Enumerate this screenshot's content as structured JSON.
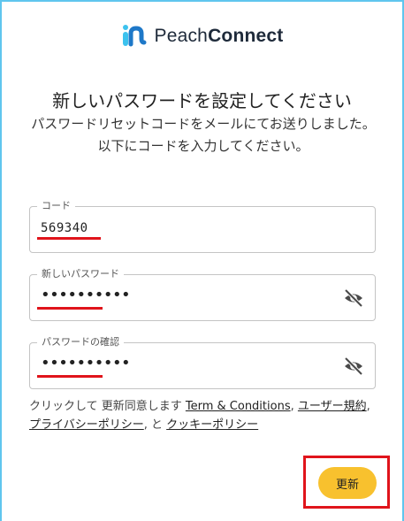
{
  "brand": {
    "name_light": "Peach",
    "name_bold": "Connect"
  },
  "page": {
    "title": "新しいパスワードを設定してください",
    "subtitle": "パスワードリセットコードをメールにてお送りしました。以下にコードを入力してください。"
  },
  "fields": {
    "code": {
      "label": "コード",
      "value": "569340"
    },
    "new_password": {
      "label": "新しいパスワード",
      "value": "••••••••••",
      "icon": "eye-off-icon"
    },
    "confirm_password": {
      "label": "パスワードの確認",
      "value": "••••••••••",
      "icon": "eye-off-icon"
    }
  },
  "consent": {
    "prefix": "クリックして 更新同意します ",
    "terms": "Term & Conditions",
    "sep1": ", ",
    "user_terms": "ユーザー規約",
    "sep2": ", ",
    "privacy": "プライバシーポリシー",
    "sep3": ", と ",
    "cookie": "クッキーポリシー"
  },
  "submit": {
    "label": "更新"
  },
  "colors": {
    "accent": "#f8c12e",
    "highlight": "#e0141b",
    "frame": "#5fc6ee",
    "logo": "#3cc2ee"
  }
}
